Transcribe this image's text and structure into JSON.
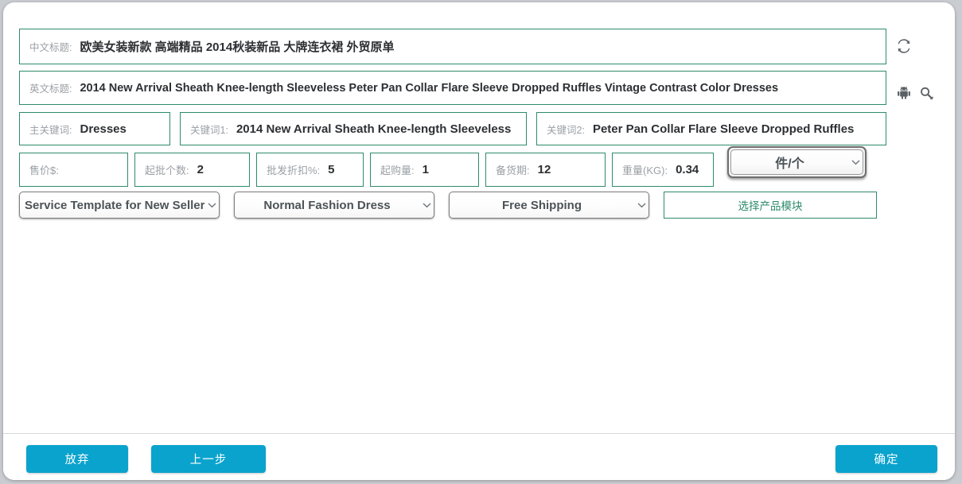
{
  "form": {
    "chinese_title": {
      "label": "中文标题:",
      "value": "欧美女装新款 高端精品 2014秋装新品 大牌连衣裙 外贸原单"
    },
    "english_title": {
      "label": "英文标题:",
      "value": "2014 New Arrival Sheath Knee-length Sleeveless Peter Pan Collar Flare Sleeve Dropped Ruffles Vintage Contrast Color Dresses"
    },
    "main_keyword": {
      "label": "主关键词:",
      "value": "Dresses"
    },
    "keyword1": {
      "label": "关键词1:",
      "value": "2014 New Arrival Sheath Knee-length Sleeveless"
    },
    "keyword2": {
      "label": "关键词2:",
      "value": "Peter Pan Collar Flare Sleeve Dropped Ruffles"
    },
    "price": {
      "label": "售价$:",
      "value": ""
    },
    "moq_pieces": {
      "label": "起批个数:",
      "value": "2"
    },
    "wholesale_discount": {
      "label": "批发折扣%:",
      "value": "5"
    },
    "min_order": {
      "label": "起购量:",
      "value": "1"
    },
    "lead_time": {
      "label": "备货期:",
      "value": "12"
    },
    "weight": {
      "label": "重量(KG):",
      "value": "0.34"
    }
  },
  "icons": {
    "refresh": "refresh-icon",
    "android": "android-icon",
    "search": "search-icon"
  },
  "selects": {
    "unit": {
      "value": "件/个",
      "options": [
        "件/个"
      ]
    },
    "service_template": {
      "value": "Service Template for New Sellers",
      "options": [
        "Service Template for New Sellers"
      ]
    },
    "category": {
      "value": "Normal Fashion Dress",
      "options": [
        "Normal Fashion Dress"
      ]
    },
    "shipping": {
      "value": "Free Shipping",
      "options": [
        "Free Shipping"
      ]
    }
  },
  "buttons": {
    "product_module": "选择产品模块",
    "abandon": "放弃",
    "previous": "上一步",
    "confirm": "确定"
  },
  "colors": {
    "field_border": "#2e8b6a",
    "accent_button": "#0aa3cd",
    "label_text": "#9aa0a6",
    "value_text": "#2d3033",
    "page_background": "#c9ccd1"
  }
}
